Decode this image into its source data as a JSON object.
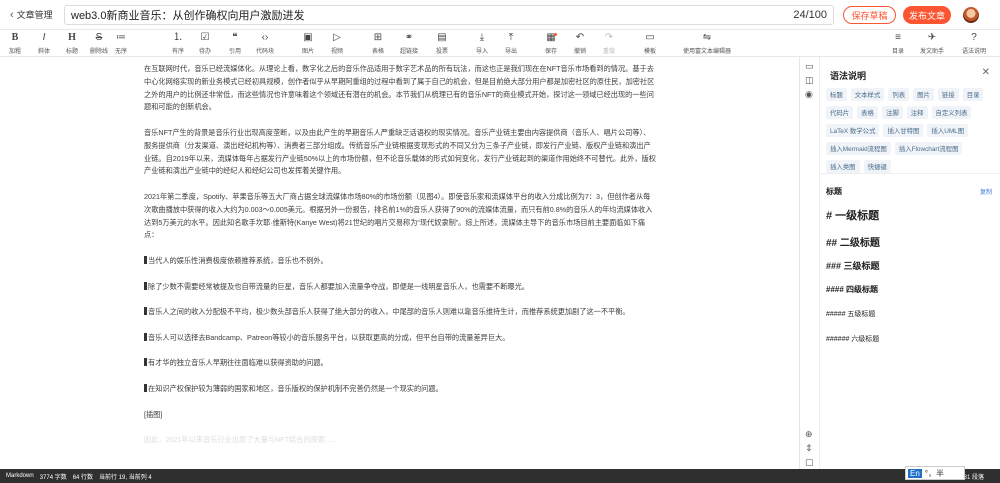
{
  "header": {
    "back_label": "文章管理",
    "title": "web3.0新商业音乐：从创作确权向用户激励进发",
    "count": "24/100",
    "save_draft": "保存草稿",
    "publish": "发布文章"
  },
  "toolbar": {
    "left": [
      {
        "icon": "B",
        "label": "加粗"
      },
      {
        "icon": "I",
        "label": "斜体"
      },
      {
        "icon": "H",
        "label": "标题"
      },
      {
        "icon": "S",
        "label": "删除线"
      },
      {
        "icon": "≔",
        "label": "无序"
      },
      {
        "icon": "⒈",
        "label": "有序"
      },
      {
        "icon": "☑",
        "label": "待办"
      },
      {
        "icon": "❝",
        "label": "引用"
      },
      {
        "icon": "‹›",
        "label": "代码块"
      },
      {
        "icon": "▣",
        "label": "图片"
      },
      {
        "icon": "▷",
        "label": "视频"
      },
      {
        "icon": "⊞",
        "label": "表格"
      },
      {
        "icon": "⚭",
        "label": "超链接"
      },
      {
        "icon": "▤",
        "label": "投票"
      },
      {
        "icon": "⤓",
        "label": "导入"
      },
      {
        "icon": "⤒",
        "label": "导出"
      },
      {
        "icon": "▦",
        "label": "保存"
      },
      {
        "icon": "↶",
        "label": "撤销"
      },
      {
        "icon": "↷",
        "label": "重做"
      },
      {
        "icon": "▭",
        "label": "模板"
      },
      {
        "icon": "⇋",
        "label": "使用富文本编辑器"
      }
    ],
    "right": [
      {
        "icon": "≡",
        "label": "目录"
      },
      {
        "icon": "✈",
        "label": "发文助手"
      },
      {
        "icon": "?",
        "label": "语法说明"
      }
    ]
  },
  "editor": {
    "paragraphs": [
      "在互联网时代，音乐已经流媒体化。从理论上看，数字化之后的音乐作品适用于数字艺术品的所有玩法，而这也正是我们现在在NFT音乐市场看到的情况。基于去中心化网络实现的新业务模式已经初具规模，创作者似乎从早期阿重组的过程中看到了属于自己的机会，但是目前绝大部分用户都是加密社区的原住民，加密社区之外的用户的比例还非常低，而这些情况也许意味着这个领域还有潜在的机会。本节我们从梳理已有的音乐NFT的商业模式开始，探讨这一领域已经出现的一些问题和可能的创新机会。",
      "音乐NFT产生的背景是音乐行业出现高度垄断，以及由此产生的早期音乐人严重缺乏话语权的现实情况。音乐产业链主要由内容提供商（音乐人、唱片公司等）、服务提供商（分发渠道、演出经纪机构等）、消费者三部分组成。传统音乐产业链根据变现形式的不同又分为三条子产业链，即发行产业链、版权产业链和演出产业链。自2019年以来，流媒体每年占据发行产业链50%以上的市场份额，但不论音乐载体的形式如何变化，发行产业链起到的渠道作用始终不可替代。此外，版权产业链和演出产业链中的经纪人和经纪公司也发挥着关键作用。",
      "2021年第二季度，Spotify、苹果音乐等五大厂商占据全球流媒体市场80%的市场份额（见图4）。即使音乐家和流媒体平台的收入分成比例为7：3，但创作者从每次歌曲播放中获得的收入大约为0.003～0.005美元。根据另外一份报告，排名前1%的音乐人获得了90%的流媒体流量，而只有前0.8%的音乐人的年均流媒体收入达到5万美元的水平。因此知名歌手坎耶·维斯特(Kanye West)将21世纪的唱片交易称为“现代奴隶制”。综上所述，流媒体主导下的音乐市场目前主要面临如下痛点："
    ],
    "bullets": [
      "当代人的娱乐性消费极度依赖推荐系统，音乐也不例外。",
      "除了少数不需要经常被提及也自带流量的巨星，音乐人都要加入流量争夺战，即便是一线明星音乐人，也需要不断曝光。",
      "音乐人之间的收入分配极不平均，极少数头部音乐人获得了绝大部分的收入，中尾部的音乐人则难以靠音乐维持生计，而推荐系统更加剧了这一不平衡。",
      "音乐人可以选择去Bandcamp、Patreon等较小的音乐服务平台，以获取更高的分成，但平台自带的流量差异巨大。",
      "有才华的独立音乐人早期往往面临难以获得资助的问题。",
      "在知识产权保护较为薄弱的国家和地区，音乐版权的保护机制不完善仍然是一个现实的问题。"
    ],
    "image_placeholder": "[插图]",
    "faint_tail": "因此，2021年以来音乐行业出现了大量与NFT结合的探索……"
  },
  "panel": {
    "title": "语法说明",
    "tags": [
      "标题",
      "文本样式",
      "列表",
      "图片",
      "链接",
      "目录",
      "代码片",
      "表格",
      "注脚",
      "注释",
      "自定义列表",
      "LaTeX 数学公式",
      "插入甘特图",
      "插入UML图",
      "插入Mermaid流程图",
      "插入Flowchart流程图",
      "插入类图",
      "快捷键"
    ],
    "section": "标题",
    "copy": "复制",
    "headings": [
      "# 一级标题",
      "## 二级标题",
      "### 三级标题",
      "#### 四级标题",
      "##### 五级标题",
      "###### 六级标题"
    ]
  },
  "status": {
    "mode": "Markdown",
    "words": "3774 字数",
    "lines": "64 行数",
    "cursor": "当前行 19, 当前列 4",
    "right": "文章已保存 31 段落"
  },
  "ime": {
    "lang": "En",
    "text": "°，半"
  }
}
